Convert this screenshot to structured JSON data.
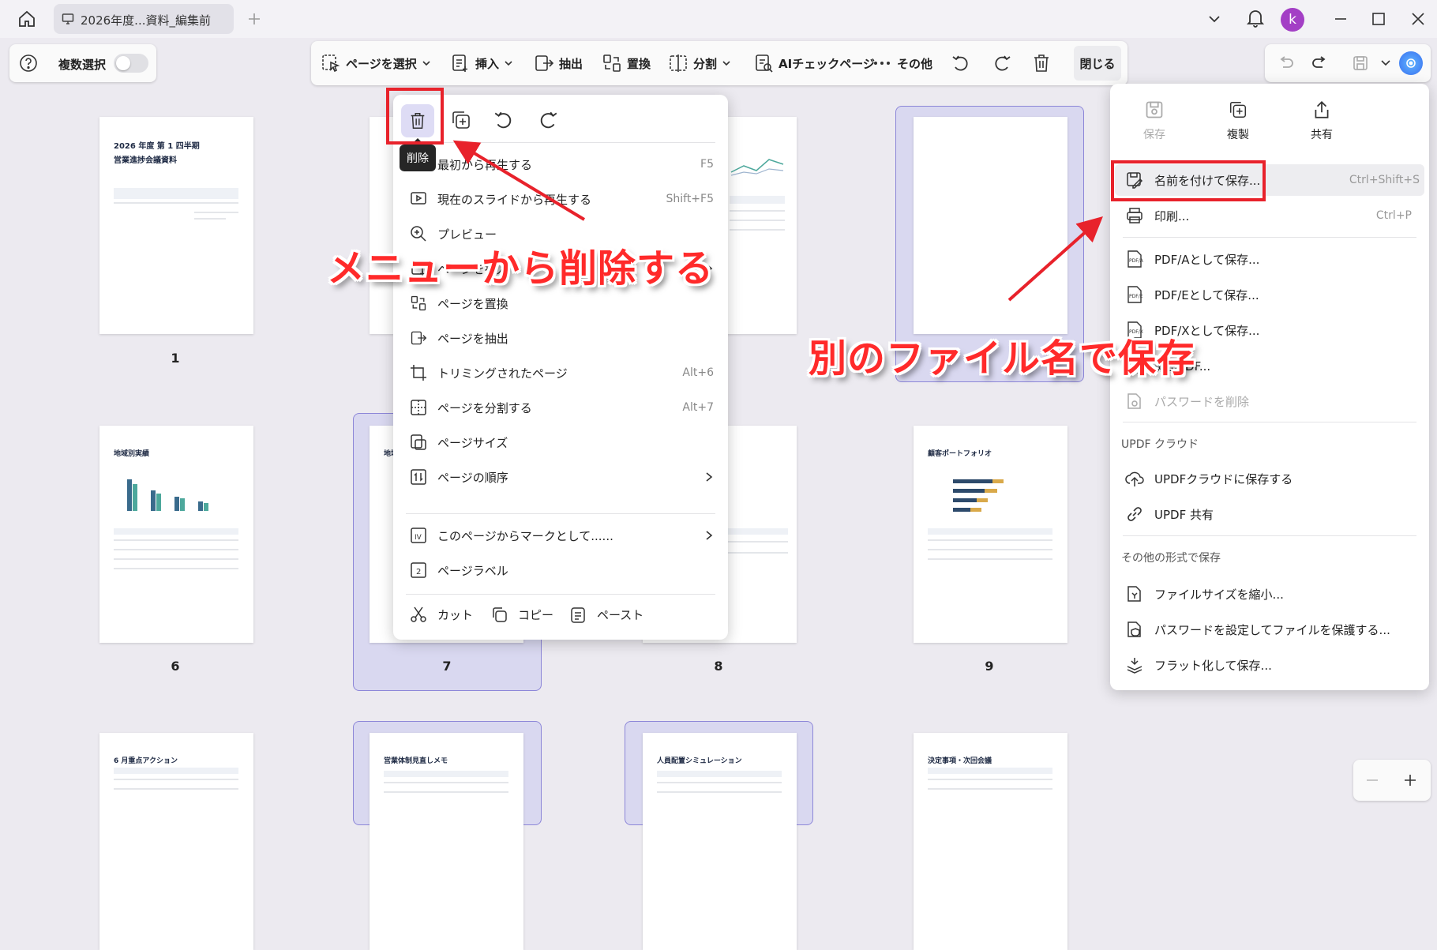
{
  "window": {
    "tab_title": "2026年度...資料_編集前",
    "avatar_letter": "k"
  },
  "toolbar_left": {
    "multi_select_label": "複数選択"
  },
  "toolbar": {
    "select_page": "ページを選択",
    "insert": "挿入",
    "extract": "抽出",
    "replace": "置換",
    "split": "分割",
    "ai_check": "AIチェックページ",
    "more": "その他",
    "close": "閉じる"
  },
  "pages": [
    {
      "num": "1",
      "title": "2026 年度 第 1 四半期",
      "title2": "営業進捗会議資料"
    },
    {
      "num": "6",
      "title": "地域別実績"
    },
    {
      "num": "7",
      "title": "地域"
    },
    {
      "num": "8"
    },
    {
      "num": "9",
      "title": "顧客ポートフォリオ"
    },
    {
      "title": "6 月重点アクション"
    },
    {
      "title": "営業体制見直しメモ"
    },
    {
      "title": "人員配置シミュレーション"
    },
    {
      "title": "決定事項・次回会議"
    }
  ],
  "context_menu": {
    "tooltip": "削除",
    "items": [
      {
        "label": "最初から再生する",
        "shortcut": "F5"
      },
      {
        "label": "現在のスライドから再生する",
        "shortcut": "Shift+F5"
      },
      {
        "label": "プレビュー"
      },
      {
        "label": "ページを挿入"
      },
      {
        "label": "ページを置換"
      },
      {
        "label": "ページを抽出"
      },
      {
        "label": "トリミングされたページ",
        "shortcut": "Alt+6"
      },
      {
        "label": "ページを分割する",
        "shortcut": "Alt+7"
      },
      {
        "label": "ページサイズ"
      },
      {
        "label": "ページの順序"
      },
      {
        "label": "このページからマークとして......"
      },
      {
        "label": "ページラベル"
      }
    ],
    "cut": "カット",
    "copy": "コピー",
    "paste": "ペースト"
  },
  "save_menu": {
    "save": "保存",
    "duplicate": "複製",
    "share": "共有",
    "save_as": "名前を付けて保存...",
    "save_as_shortcut": "Ctrl+Shift+S",
    "print": "印刷...",
    "print_shortcut": "Ctrl+P",
    "pdfa": "PDF/Aとして保存...",
    "pdfe": "PDF/Eとして保存...",
    "pdfx": "PDF/Xとして保存...",
    "secure": "機密PDF...",
    "remove_password": "パスワードを削除",
    "cloud_header": "UPDF クラウド",
    "save_cloud": "UPDFクラウドに保存する",
    "updf_share": "UPDF 共有",
    "other_header": "その他の形式で保存",
    "reduce": "ファイルサイズを縮小...",
    "protect": "パスワードを設定してファイルを保護する...",
    "flatten": "フラット化して保存..."
  },
  "annotations": {
    "menu_delete": "メニューから削除する",
    "save_as_other": "別のファイル名で保存"
  },
  "colors": {
    "accent": "#e8222b",
    "selection": "#d9d8f0",
    "avatar": "#a33fc5"
  }
}
